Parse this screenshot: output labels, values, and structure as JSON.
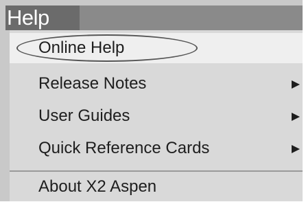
{
  "menubar": {
    "title": "Help"
  },
  "menu": {
    "items": [
      {
        "label": "Online Help",
        "has_submenu": false,
        "highlighted": true,
        "circled": true
      },
      {
        "label": "Release Notes",
        "has_submenu": true
      },
      {
        "label": "User Guides",
        "has_submenu": true
      },
      {
        "label": "Quick Reference Cards",
        "has_submenu": true
      },
      {
        "label": "About X2 Aspen",
        "has_submenu": false
      }
    ]
  },
  "icons": {
    "submenu_arrow": "triangle-right-icon"
  },
  "colors": {
    "menubar_bg": "#8a8a8a",
    "menubar_title_bg": "#6b6b6b",
    "menu_bg": "#d9d9d9",
    "highlight_bg": "#efefef",
    "text": "#1e1e1e"
  }
}
